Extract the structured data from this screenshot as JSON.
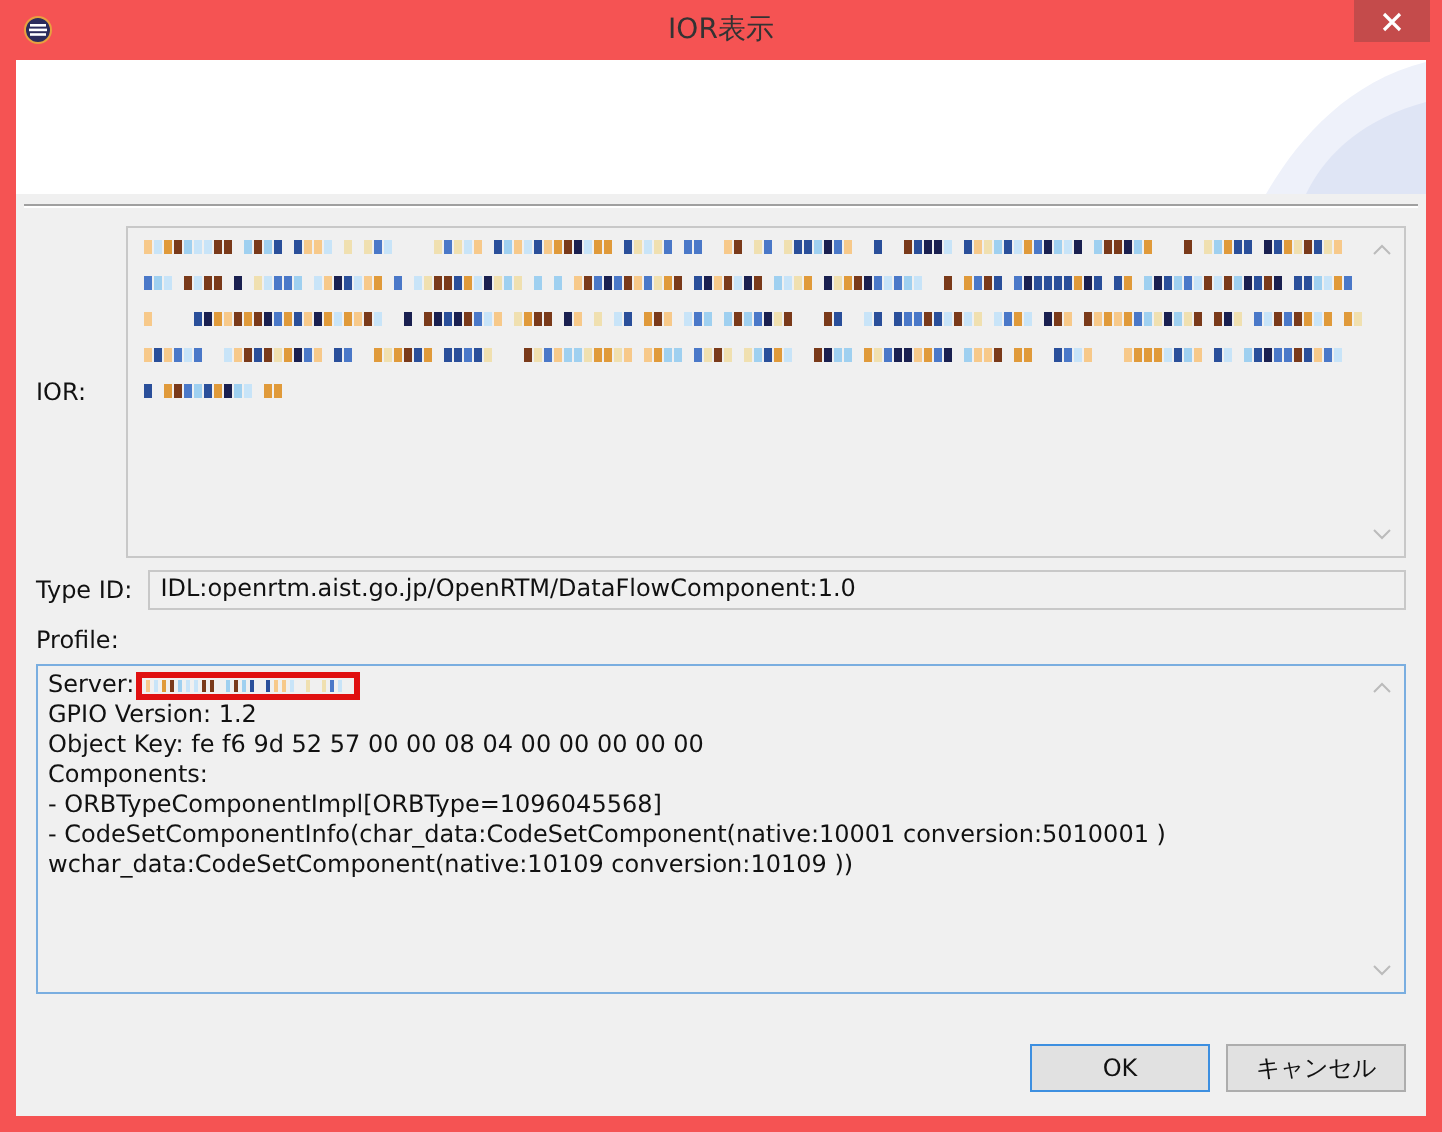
{
  "window": {
    "title": "IOR表示"
  },
  "ior": {
    "label": "IOR:"
  },
  "type_id": {
    "label": "Type ID:",
    "value": "IDL:openrtm.aist.go.jp/OpenRTM/DataFlowComponent:1.0"
  },
  "profile": {
    "label": "Profile:",
    "server_label": "Server:",
    "lines": [
      "GPIO Version: 1.2",
      "Object Key: fe f6 9d 52 57 00 00 08 04 00 00 00 00 00",
      "Components:",
      "- ORBTypeComponentImpl[ORBType=1096045568]",
      "- CodeSetComponentInfo(char_data:CodeSetComponent(native:10001 conversion:5010001 )",
      "wchar_data:CodeSetComponent(native:10109 conversion:10109 ))"
    ]
  },
  "buttons": [
    {
      "label": "OK",
      "selected": true
    },
    {
      "label": "キャンセル",
      "selected": false
    }
  ]
}
